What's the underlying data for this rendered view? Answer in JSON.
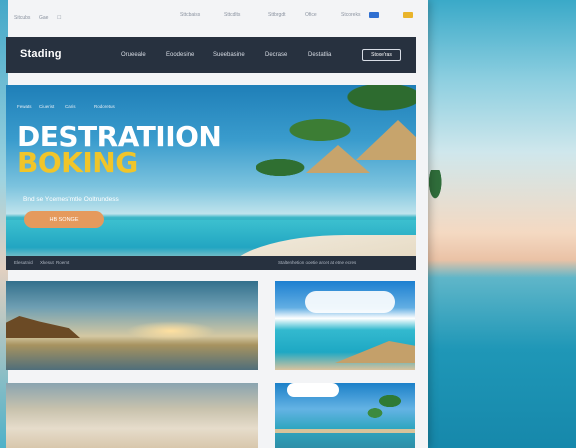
{
  "util_bar": {
    "links": [
      "Sitcubs",
      "Gae",
      "Sttcbaiss",
      "Sttcdlts",
      "Sttbrgdt",
      "Ofice",
      "Stcoreks"
    ]
  },
  "nav": {
    "logo": "Stading",
    "links": [
      "Orueeale",
      "Eoodesine",
      "Sueebasine",
      "Decrase",
      "Destatlia"
    ],
    "button": "Stoxe'ras"
  },
  "hero": {
    "breadcrumbs": [
      "Fewats",
      "Ciuerist",
      "Caris",
      "Rodoretus"
    ],
    "title_line1": "DESTRATIION",
    "title_line2": "BOKING",
    "subtitle": "Bnd se Ycemes'mtle Ooltrundess",
    "cta": "HB SONGE"
  },
  "strip": {
    "left": [
      "Elesutnicl",
      "Xkesut",
      "Roemt"
    ],
    "right": [
      "Staltenhetion ooetie arcet at etne ecres"
    ]
  },
  "colors": {
    "nav_bg": "#27313f",
    "title_white": "#ffffff",
    "title_yellow": "#f0c52a",
    "cta": "#e59a5d"
  }
}
